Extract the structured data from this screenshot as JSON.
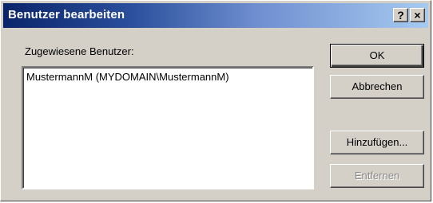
{
  "window": {
    "title": "Benutzer bearbeiten",
    "help_label": "?",
    "close_label": "×"
  },
  "main": {
    "list_label": "Zugewiesene Benutzer:",
    "users": [
      "MustermannM (MYDOMAIN\\MustermannM)"
    ]
  },
  "buttons": {
    "ok": "OK",
    "cancel": "Abbrechen",
    "add": "Hinzufügen...",
    "remove": "Entfernen"
  }
}
